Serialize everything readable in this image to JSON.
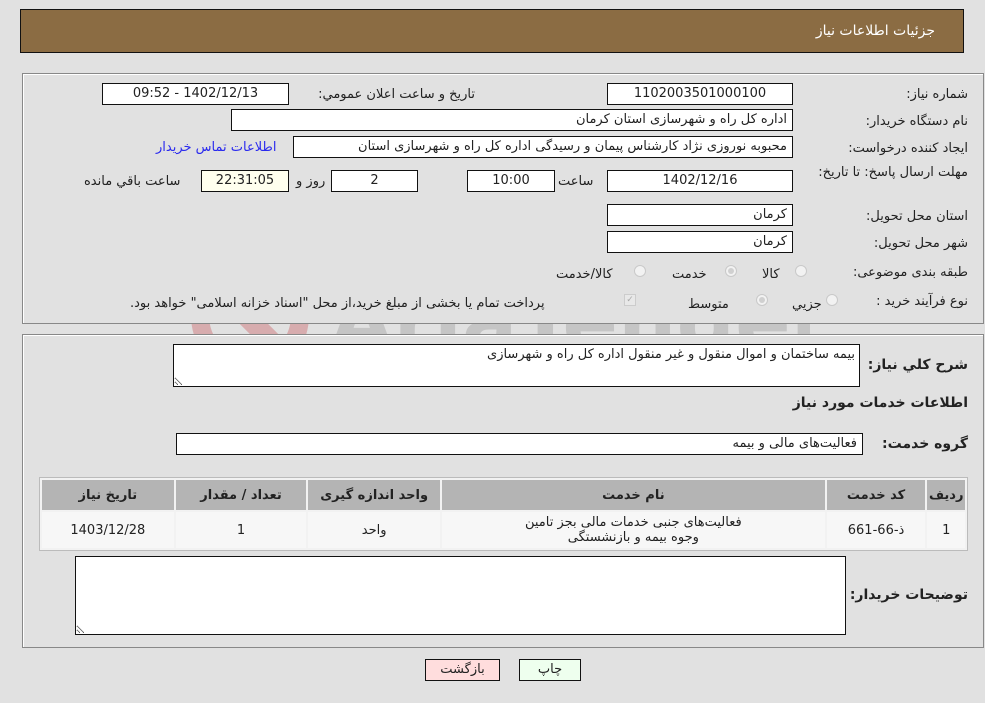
{
  "header": {
    "title": "جزئیات اطلاعات نیاز"
  },
  "form": {
    "need_number": {
      "label": "شماره نیاز:",
      "value": "1102003501000100"
    },
    "announce_datetime": {
      "label": "تاریخ و ساعت اعلان عمومي:",
      "value": "1402/12/13 - 09:52"
    },
    "buyer_org": {
      "label": "نام دستگاه خریدار:",
      "value": "اداره کل راه و شهرسازی استان کرمان"
    },
    "requester": {
      "label": "ایجاد کننده درخواست:",
      "value": "محبوبه نوروزی نژاد کارشناس پیمان و رسیدگی اداره کل راه و شهرسازی استان",
      "contact_link": "اطلاعات تماس خریدار"
    },
    "deadline": {
      "label": "مهلت ارسال پاسخ: تا تاریخ:",
      "date": "1402/12/16",
      "time_label": "ساعت",
      "time": "10:00",
      "days": "2",
      "days_label": "روز و",
      "remaining": "22:31:05",
      "remaining_label": "ساعت باقي مانده"
    },
    "delivery_province": {
      "label": "استان محل تحویل:",
      "value": "کرمان"
    },
    "delivery_city": {
      "label": "شهر محل تحویل:",
      "value": "کرمان"
    },
    "category": {
      "label": "طبقه بندی موضوعی:",
      "options": [
        "کالا",
        "خدمت",
        "کالا/خدمت"
      ],
      "selected": "خدمت"
    },
    "purchase_type": {
      "label": "نوع فرآیند خرید :",
      "options": [
        "جزيي",
        "متوسط"
      ],
      "selected": "متوسط",
      "treasury_note": "پرداخت تمام یا بخشی از مبلغ خرید،از محل \"اسناد خزانه اسلامی\" خواهد بود.",
      "treasury_checked": true
    }
  },
  "details": {
    "description_label": "شرح کلي نیاز:",
    "description": "بیمه ساختمان و اموال منقول و غیر منقول اداره کل راه و شهرسازی",
    "services_heading": "اطلاعات خدمات مورد نیاز",
    "service_group_label": "گروه خدمت:",
    "service_group": "فعالیت‌های مالی و بیمه",
    "table": {
      "headers": [
        "ردیف",
        "کد خدمت",
        "نام خدمت",
        "واحد اندازه گیری",
        "تعداد / مقدار",
        "تاریخ نیاز"
      ],
      "rows": [
        [
          "1",
          "ذ-66-661",
          "فعالیت‌های جنبی خدمات مالی بجز تامین وجوه بیمه و بازنشستگی",
          "واحد",
          "1",
          "1403/12/28"
        ]
      ]
    },
    "buyer_notes_label": "توضیحات خریدار:",
    "buyer_notes": ""
  },
  "buttons": {
    "print": "چاپ",
    "back": "بازگشت"
  },
  "watermark": {
    "text": "AriaTender.neT"
  },
  "colors": {
    "header_bg": "#8b6c43",
    "link": "#2a2aee",
    "print_bg": "#eeffee",
    "back_bg": "#ffdddd"
  }
}
